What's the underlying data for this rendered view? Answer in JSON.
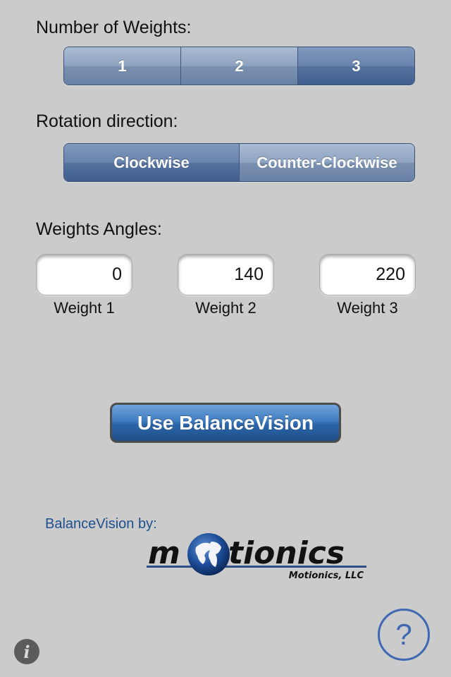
{
  "weights_section": {
    "label": "Number of Weights:",
    "options": [
      "1",
      "2",
      "3"
    ],
    "selected": "3"
  },
  "rotation_section": {
    "label": "Rotation direction:",
    "options": [
      "Clockwise",
      "Counter-Clockwise"
    ],
    "selected": "Clockwise"
  },
  "angles_section": {
    "label": "Weights Angles:",
    "weights": [
      {
        "label": "Weight 1",
        "value": "0"
      },
      {
        "label": "Weight 2",
        "value": "140"
      },
      {
        "label": "Weight 3",
        "value": "220"
      }
    ]
  },
  "use_button": {
    "label": "Use BalanceVision"
  },
  "credits": {
    "by_label": "BalanceVision by:",
    "logo_text_left": "m",
    "logo_text_right": "tionics",
    "logo_subtitle": "Motionics, LLC"
  },
  "footer": {
    "info_icon": "i",
    "help_icon": "?"
  },
  "colors": {
    "background": "#cbcbcb",
    "accent_blue": "#1e4f8e",
    "help_blue": "#3f68b2"
  }
}
